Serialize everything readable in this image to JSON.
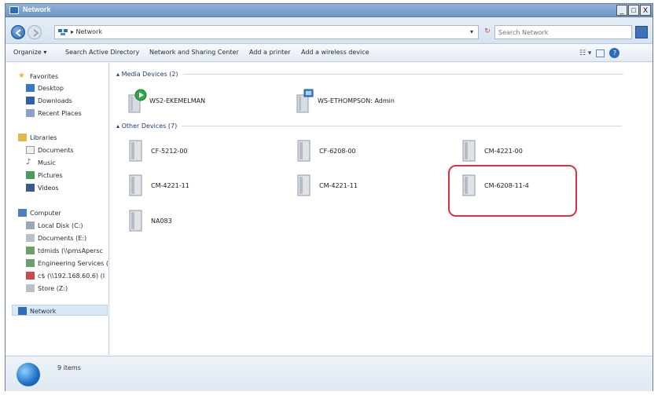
{
  "window": {
    "title": "Network",
    "controls": [
      "_",
      "□",
      "X"
    ]
  },
  "address": {
    "path": "▸ Network",
    "dropdown": "▾",
    "refresh": "↻"
  },
  "search": {
    "placeholder": "Search Network"
  },
  "toolbar": {
    "organize": "Organize ▾",
    "search_ad": "Search Active Directory",
    "network_sharing": "Network and Sharing Center",
    "add_printer": "Add a printer",
    "add_wireless": "Add a wireless device",
    "view": "☷ ▾",
    "help": "?"
  },
  "nav": {
    "favorites": "Favorites",
    "desktop": "Desktop",
    "downloads": "Downloads",
    "recent": "Recent Places",
    "libraries": "Libraries",
    "documents": "Documents",
    "music": "Music",
    "pictures": "Pictures",
    "videos": "Videos",
    "computer": "Computer",
    "local_disk": "Local Disk (C:)",
    "documents_e": "Documents (E:)",
    "share1": "tdmids (\\\\pmsApersc",
    "eng_services": "Engineering Services (",
    "cs_share": "c$ (\\\\192.168.60.6) (I",
    "store": "Store (Z:)",
    "network": "Network"
  },
  "groups": {
    "media": "Media Devices (2)",
    "other": "Other Devices (7)"
  },
  "media_devices": [
    {
      "label": "WS2-EKEMELMAN"
    },
    {
      "label": "WS-ETHOMPSON: Admin"
    }
  ],
  "other_devices": [
    {
      "label": "CF-5212-00"
    },
    {
      "label": "CF-6208-00"
    },
    {
      "label": "CM-4221-00"
    },
    {
      "label": "CM-4221-11"
    },
    {
      "label": "CM-4221-11"
    },
    {
      "label": "CM-6208-11-4"
    },
    {
      "label": "NA083"
    }
  ],
  "status": {
    "items": "9 items"
  },
  "colors": {
    "highlight": "#d9343c",
    "titlebar": "#7a9ccb",
    "accent": "#2c6bc2"
  }
}
